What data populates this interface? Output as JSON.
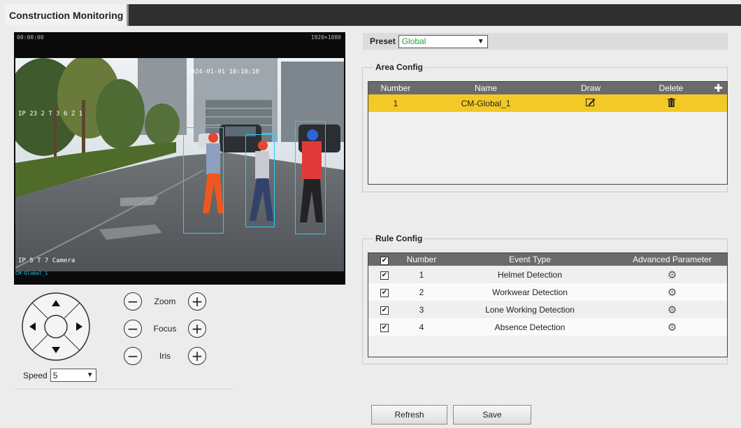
{
  "header": {
    "title": "Construction Monitoring"
  },
  "video": {
    "osd_top_left": "00:00:00",
    "osd_top_right": "1920×1080",
    "osd_timestamp": "2024-01-01 10:10:10",
    "osd_left_label": "IP 23 2 T 3 6 Z 1",
    "osd_bottom_left": "IP 5 T 7 Camera",
    "osd_bottom_tag": "CM-Global_1"
  },
  "ptz": {
    "zoom_label": "Zoom",
    "focus_label": "Focus",
    "iris_label": "Iris",
    "minus_symbol": "−",
    "plus_symbol": "+",
    "speed_label": "Speed",
    "speed_value": "5"
  },
  "preset": {
    "label": "Preset",
    "value": "Global"
  },
  "area_config": {
    "legend": "Area Config",
    "columns": [
      "Number",
      "Name",
      "Draw",
      "Delete"
    ],
    "rows": [
      {
        "number": "1",
        "name": "CM-Global_1"
      }
    ]
  },
  "rule_config": {
    "legend": "Rule Config",
    "columns": [
      "Number",
      "Event Type",
      "Advanced Parameter"
    ],
    "rows": [
      {
        "number": "1",
        "event": "Helmet Detection",
        "checked": true
      },
      {
        "number": "2",
        "event": "Workwear Detection",
        "checked": true
      },
      {
        "number": "3",
        "event": "Lone Working Detection",
        "checked": true
      },
      {
        "number": "4",
        "event": "Absence Detection",
        "checked": true
      }
    ]
  },
  "actions": {
    "refresh": "Refresh",
    "save": "Save"
  },
  "colors": {
    "accent_yellow": "#f3c928",
    "header_gray": "#6b6b6b",
    "preset_green": "#1fa33b"
  }
}
